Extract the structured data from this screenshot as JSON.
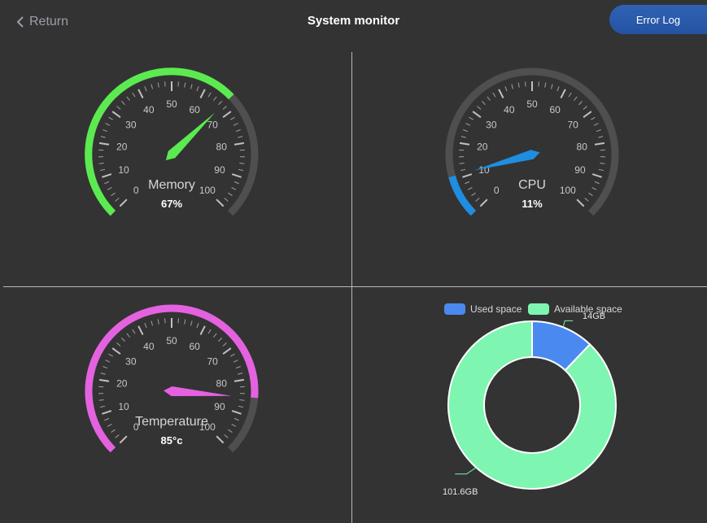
{
  "header": {
    "return_label": "Return",
    "title": "System monitor",
    "error_log_label": "Error Log"
  },
  "colors": {
    "background": "#333333",
    "track": "#4f4f4f",
    "ticks": "#d0d0d0",
    "memory": "#5beb51",
    "cpu": "#1f8de0",
    "temperature": "#e462e0",
    "used_space": "#4a8af0",
    "available_space": "#7ef5b0",
    "button": "#2a5cad"
  },
  "gauges": [
    {
      "key": "memory",
      "name": "Memory",
      "value_text": "67%",
      "value": 67,
      "min": 0,
      "max": 100,
      "tick_labels": [
        "0",
        "10",
        "20",
        "30",
        "40",
        "50",
        "60",
        "70",
        "80",
        "90",
        "100"
      ]
    },
    {
      "key": "cpu",
      "name": "CPU",
      "value_text": "11%",
      "value": 11,
      "min": 0,
      "max": 100,
      "tick_labels": [
        "0",
        "10",
        "20",
        "30",
        "40",
        "50",
        "60",
        "70",
        "80",
        "90",
        "100"
      ]
    },
    {
      "key": "temperature",
      "name": "Temperature",
      "value_text": "85°c",
      "value": 85,
      "min": 0,
      "max": 100,
      "tick_labels": [
        "0",
        "10",
        "20",
        "30",
        "40",
        "50",
        "60",
        "70",
        "80",
        "90",
        "100"
      ]
    }
  ],
  "disk": {
    "legend": [
      {
        "name": "Used space",
        "color_key": "used_space"
      },
      {
        "name": "Available space",
        "color_key": "available_space"
      }
    ],
    "used_label": "14GB",
    "available_label": "101.6GB",
    "used_gb": 14,
    "available_gb": 101.6
  },
  "chart_data": {
    "type": "pie",
    "categories": [
      "Used space",
      "Available space"
    ],
    "values": [
      14,
      101.6
    ],
    "data_labels": [
      "14GB",
      "101.6GB"
    ],
    "legend_position": "top"
  }
}
